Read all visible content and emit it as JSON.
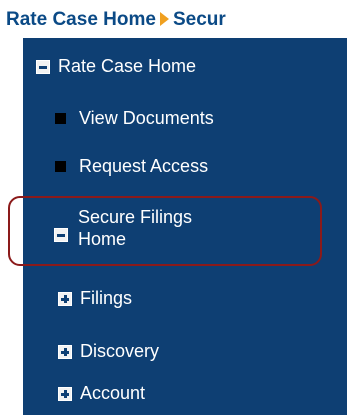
{
  "breadcrumb": {
    "root": "Rate Case Home",
    "current": "Secur"
  },
  "nav": {
    "rate_case_home": "Rate Case Home",
    "view_documents": "View Documents",
    "request_access": "Request Access",
    "secure_filings_line1": "Secure Filings",
    "secure_filings_line2": "Home",
    "filings": "Filings",
    "discovery": "Discovery",
    "account": "Account"
  },
  "colors": {
    "panel": "#0e3f73",
    "breadcrumb_text": "#0b4a86",
    "breadcrumb_separator": "#f0a020",
    "highlight": "#8b1a1a"
  },
  "icons": {
    "expanded": "minus-box-icon",
    "leaf": "square-bullet-icon",
    "collapsed": "plus-box-icon",
    "separator": "triangle-right-icon"
  }
}
